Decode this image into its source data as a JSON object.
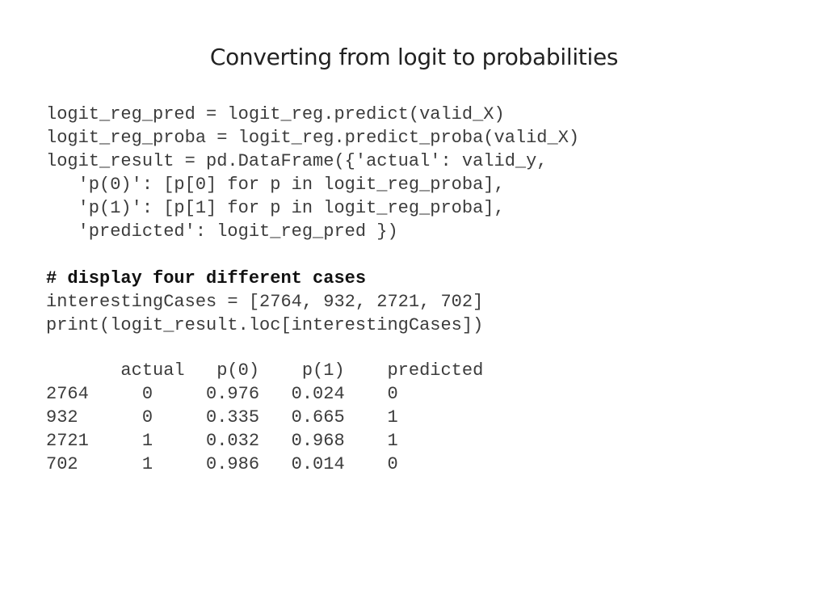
{
  "slide": {
    "title": "Converting from logit to probabilities"
  },
  "code": {
    "lines": [
      "logit_reg_pred = logit_reg.predict(valid_X)",
      "logit_reg_proba = logit_reg.predict_proba(valid_X)",
      "logit_result = pd.DataFrame({'actual': valid_y,",
      "   'p(0)': [p[0] for p in logit_reg_proba],",
      "   'p(1)': [p[1] for p in logit_reg_proba],",
      "   'predicted': logit_reg_pred })",
      "",
      "# display four different cases",
      "interestingCases = [2764, 932, 2721, 702]",
      "print(logit_result.loc[interestingCases])"
    ]
  },
  "output": {
    "header": "       actual   p(0)    p(1)    predicted",
    "rows": [
      "2764     0     0.976   0.024    0",
      "932      0     0.335   0.665    1",
      "2721     1     0.032   0.968    1",
      "702      1     0.986   0.014    0"
    ]
  }
}
